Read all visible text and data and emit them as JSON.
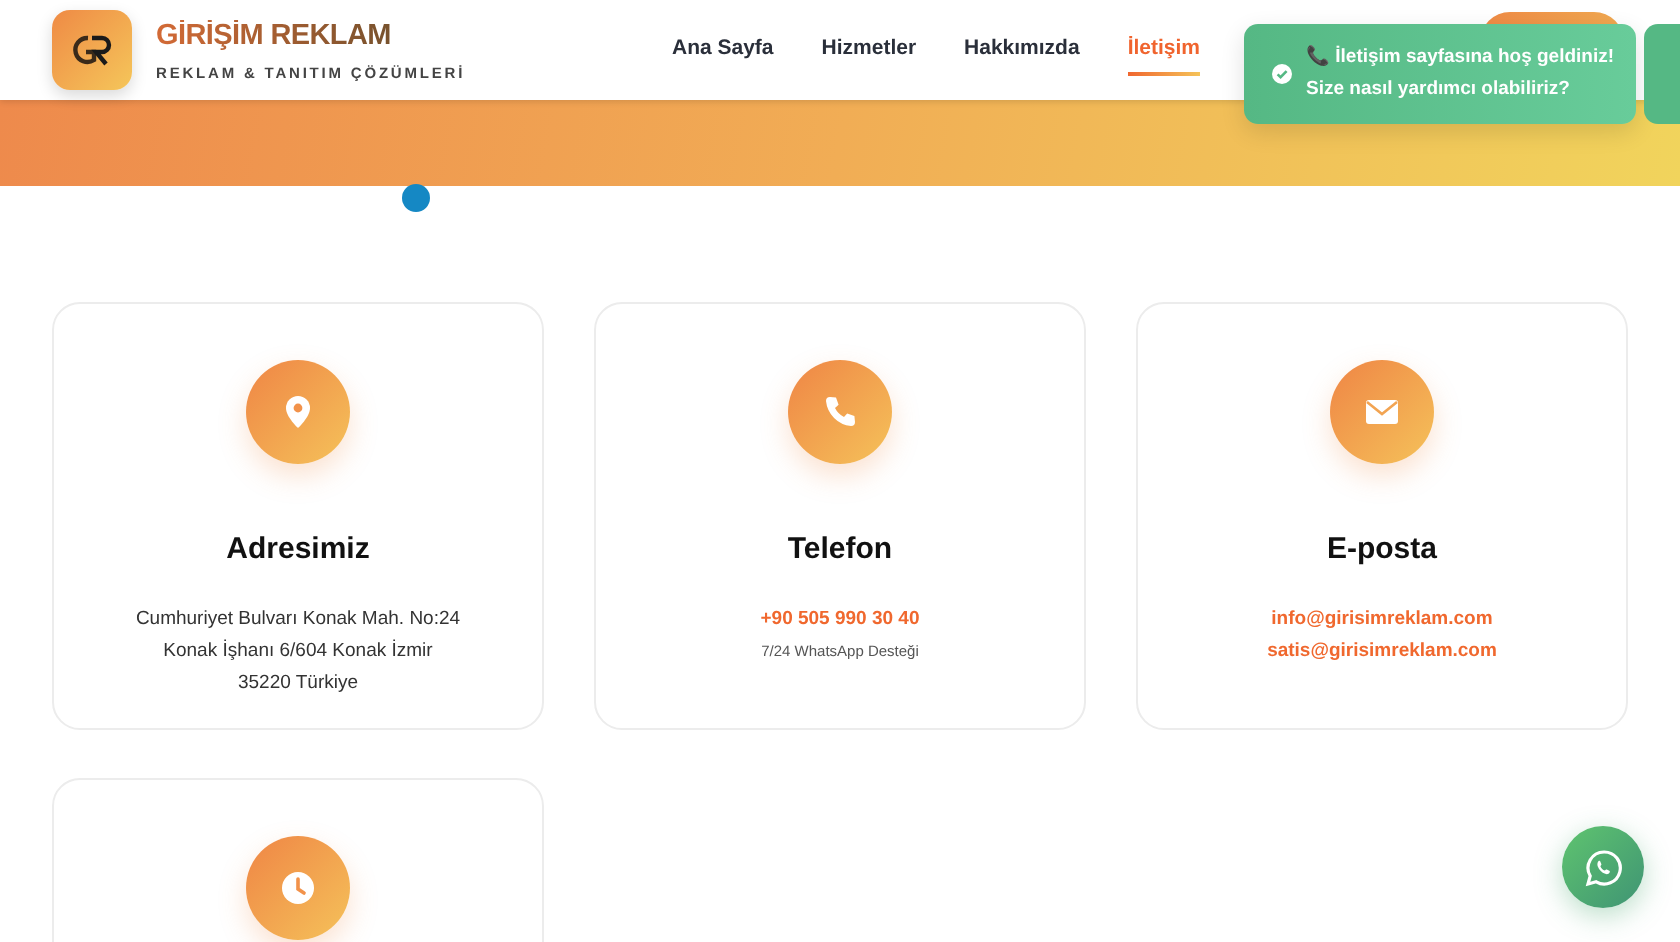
{
  "brand": {
    "name": "GİRİŞİM REKLAM",
    "tagline": "REKLAM & TANITIM ÇÖZÜMLERİ"
  },
  "nav": [
    {
      "label": "Ana Sayfa",
      "selected": false
    },
    {
      "label": "Hizmetler",
      "selected": false
    },
    {
      "label": "Hakkımızda",
      "selected": false
    },
    {
      "label": "İletişim",
      "selected": true
    }
  ],
  "toast": {
    "icon": "📞",
    "lines": [
      "İletişim sayfasına hoş geldiniz!",
      "Size nasıl yardımcı olabiliriz?"
    ]
  },
  "cards": [
    {
      "kind": "location",
      "title": "Adresimiz",
      "lines": [
        {
          "text": "Cumhuriyet Bulvarı Konak Mah. No:24",
          "kind": "plain"
        },
        {
          "text": "Konak İşhanı 6/604 Konak İzmir",
          "kind": "plain"
        },
        {
          "text": "35220 Türkiye",
          "kind": "plain"
        }
      ]
    },
    {
      "kind": "phone",
      "title": "Telefon",
      "lines": [
        {
          "text": "+90 505 990 30 40",
          "kind": "link"
        },
        {
          "text": "7/24 WhatsApp Desteği",
          "kind": "note"
        }
      ]
    },
    {
      "kind": "mail",
      "title": "E-posta",
      "lines": [
        {
          "text": "info@girisimreklam.com",
          "kind": "link"
        },
        {
          "text": "satis@girisimreklam.com",
          "kind": "link"
        }
      ]
    },
    {
      "kind": "clock"
    }
  ]
}
